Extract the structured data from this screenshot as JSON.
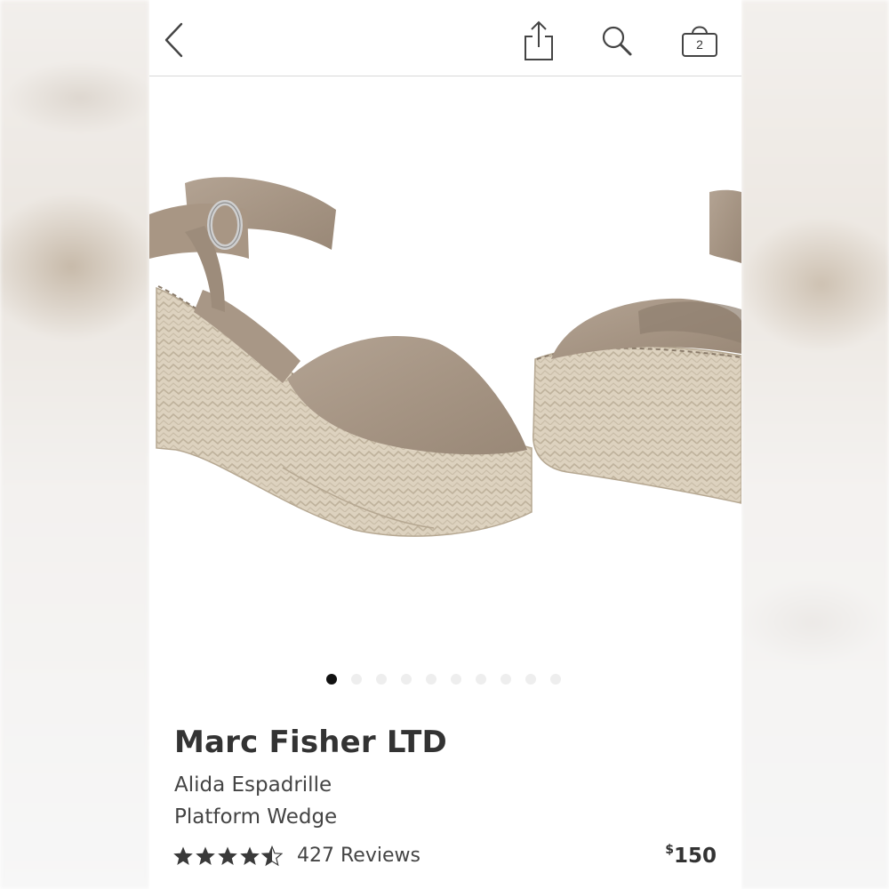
{
  "header": {
    "back_icon": "chevron-left-icon",
    "share_icon": "share-icon",
    "search_icon": "search-icon",
    "bag_icon": "shopping-bag-icon",
    "bag_count": "2"
  },
  "gallery": {
    "image_description": "product-photo",
    "total_images": 10,
    "active_index": 0
  },
  "product": {
    "brand": "Marc Fisher LTD",
    "name_line1": "Alida Espadrille",
    "name_line2": "Platform Wedge",
    "rating": 4.5,
    "reviews": "427 Reviews",
    "currency": "$",
    "price": "150"
  },
  "colors": {
    "text_dark": "#333333",
    "dot_active": "#111111",
    "dot_inactive": "#eeeeee",
    "divider": "#d8d8d8"
  }
}
